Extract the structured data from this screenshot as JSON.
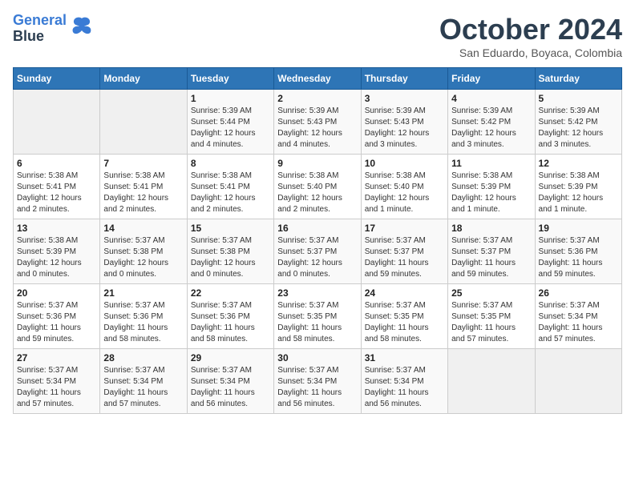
{
  "logo": {
    "line1": "General",
    "line2": "Blue"
  },
  "title": "October 2024",
  "location": "San Eduardo, Boyaca, Colombia",
  "headers": [
    "Sunday",
    "Monday",
    "Tuesday",
    "Wednesday",
    "Thursday",
    "Friday",
    "Saturday"
  ],
  "weeks": [
    [
      {
        "day": "",
        "info": ""
      },
      {
        "day": "",
        "info": ""
      },
      {
        "day": "1",
        "info": "Sunrise: 5:39 AM\nSunset: 5:44 PM\nDaylight: 12 hours\nand 4 minutes."
      },
      {
        "day": "2",
        "info": "Sunrise: 5:39 AM\nSunset: 5:43 PM\nDaylight: 12 hours\nand 4 minutes."
      },
      {
        "day": "3",
        "info": "Sunrise: 5:39 AM\nSunset: 5:43 PM\nDaylight: 12 hours\nand 3 minutes."
      },
      {
        "day": "4",
        "info": "Sunrise: 5:39 AM\nSunset: 5:42 PM\nDaylight: 12 hours\nand 3 minutes."
      },
      {
        "day": "5",
        "info": "Sunrise: 5:39 AM\nSunset: 5:42 PM\nDaylight: 12 hours\nand 3 minutes."
      }
    ],
    [
      {
        "day": "6",
        "info": "Sunrise: 5:38 AM\nSunset: 5:41 PM\nDaylight: 12 hours\nand 2 minutes."
      },
      {
        "day": "7",
        "info": "Sunrise: 5:38 AM\nSunset: 5:41 PM\nDaylight: 12 hours\nand 2 minutes."
      },
      {
        "day": "8",
        "info": "Sunrise: 5:38 AM\nSunset: 5:41 PM\nDaylight: 12 hours\nand 2 minutes."
      },
      {
        "day": "9",
        "info": "Sunrise: 5:38 AM\nSunset: 5:40 PM\nDaylight: 12 hours\nand 2 minutes."
      },
      {
        "day": "10",
        "info": "Sunrise: 5:38 AM\nSunset: 5:40 PM\nDaylight: 12 hours\nand 1 minute."
      },
      {
        "day": "11",
        "info": "Sunrise: 5:38 AM\nSunset: 5:39 PM\nDaylight: 12 hours\nand 1 minute."
      },
      {
        "day": "12",
        "info": "Sunrise: 5:38 AM\nSunset: 5:39 PM\nDaylight: 12 hours\nand 1 minute."
      }
    ],
    [
      {
        "day": "13",
        "info": "Sunrise: 5:38 AM\nSunset: 5:39 PM\nDaylight: 12 hours\nand 0 minutes."
      },
      {
        "day": "14",
        "info": "Sunrise: 5:37 AM\nSunset: 5:38 PM\nDaylight: 12 hours\nand 0 minutes."
      },
      {
        "day": "15",
        "info": "Sunrise: 5:37 AM\nSunset: 5:38 PM\nDaylight: 12 hours\nand 0 minutes."
      },
      {
        "day": "16",
        "info": "Sunrise: 5:37 AM\nSunset: 5:37 PM\nDaylight: 12 hours\nand 0 minutes."
      },
      {
        "day": "17",
        "info": "Sunrise: 5:37 AM\nSunset: 5:37 PM\nDaylight: 11 hours\nand 59 minutes."
      },
      {
        "day": "18",
        "info": "Sunrise: 5:37 AM\nSunset: 5:37 PM\nDaylight: 11 hours\nand 59 minutes."
      },
      {
        "day": "19",
        "info": "Sunrise: 5:37 AM\nSunset: 5:36 PM\nDaylight: 11 hours\nand 59 minutes."
      }
    ],
    [
      {
        "day": "20",
        "info": "Sunrise: 5:37 AM\nSunset: 5:36 PM\nDaylight: 11 hours\nand 59 minutes."
      },
      {
        "day": "21",
        "info": "Sunrise: 5:37 AM\nSunset: 5:36 PM\nDaylight: 11 hours\nand 58 minutes."
      },
      {
        "day": "22",
        "info": "Sunrise: 5:37 AM\nSunset: 5:36 PM\nDaylight: 11 hours\nand 58 minutes."
      },
      {
        "day": "23",
        "info": "Sunrise: 5:37 AM\nSunset: 5:35 PM\nDaylight: 11 hours\nand 58 minutes."
      },
      {
        "day": "24",
        "info": "Sunrise: 5:37 AM\nSunset: 5:35 PM\nDaylight: 11 hours\nand 58 minutes."
      },
      {
        "day": "25",
        "info": "Sunrise: 5:37 AM\nSunset: 5:35 PM\nDaylight: 11 hours\nand 57 minutes."
      },
      {
        "day": "26",
        "info": "Sunrise: 5:37 AM\nSunset: 5:34 PM\nDaylight: 11 hours\nand 57 minutes."
      }
    ],
    [
      {
        "day": "27",
        "info": "Sunrise: 5:37 AM\nSunset: 5:34 PM\nDaylight: 11 hours\nand 57 minutes."
      },
      {
        "day": "28",
        "info": "Sunrise: 5:37 AM\nSunset: 5:34 PM\nDaylight: 11 hours\nand 57 minutes."
      },
      {
        "day": "29",
        "info": "Sunrise: 5:37 AM\nSunset: 5:34 PM\nDaylight: 11 hours\nand 56 minutes."
      },
      {
        "day": "30",
        "info": "Sunrise: 5:37 AM\nSunset: 5:34 PM\nDaylight: 11 hours\nand 56 minutes."
      },
      {
        "day": "31",
        "info": "Sunrise: 5:37 AM\nSunset: 5:34 PM\nDaylight: 11 hours\nand 56 minutes."
      },
      {
        "day": "",
        "info": ""
      },
      {
        "day": "",
        "info": ""
      }
    ]
  ]
}
